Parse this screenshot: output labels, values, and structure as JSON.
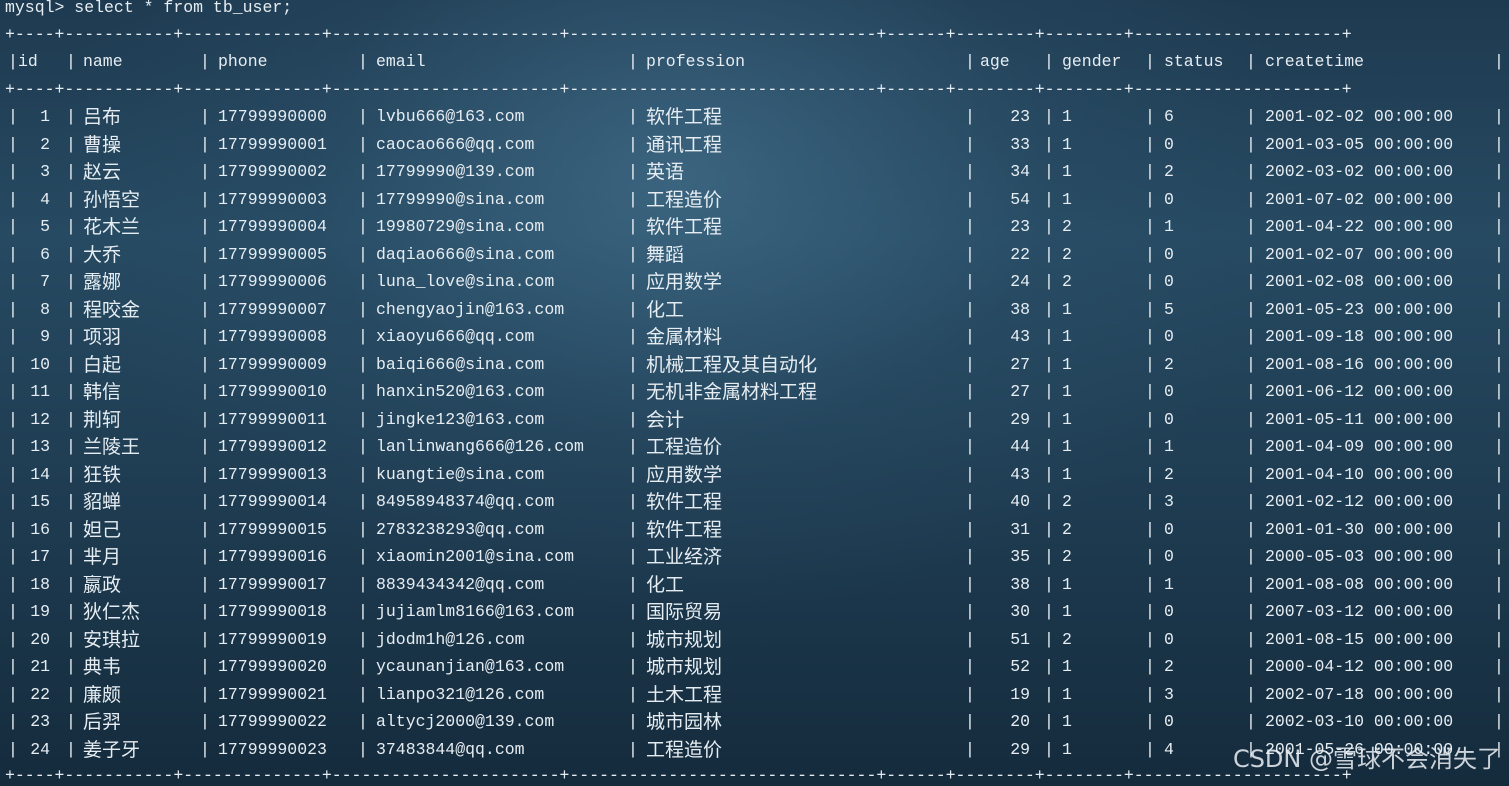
{
  "terminal": {
    "command": "mysql> select * from tb_user;",
    "border": "+----+-----------+--------------+-----------------------+-------------------------------+------+--------+--------+---------------------+",
    "columns": [
      "id",
      "name",
      "phone",
      "email",
      "profession",
      "age",
      "gender",
      "status",
      "createtime"
    ],
    "rows": [
      [
        "1",
        "吕布",
        "17799990000",
        "lvbu666@163.com",
        "软件工程",
        "23",
        "1",
        "6",
        "2001-02-02 00:00:00"
      ],
      [
        "2",
        "曹操",
        "17799990001",
        "caocao666@qq.com",
        "通讯工程",
        "33",
        "1",
        "0",
        "2001-03-05 00:00:00"
      ],
      [
        "3",
        "赵云",
        "17799990002",
        "17799990@139.com",
        "英语",
        "34",
        "1",
        "2",
        "2002-03-02 00:00:00"
      ],
      [
        "4",
        "孙悟空",
        "17799990003",
        "17799990@sina.com",
        "工程造价",
        "54",
        "1",
        "0",
        "2001-07-02 00:00:00"
      ],
      [
        "5",
        "花木兰",
        "17799990004",
        "19980729@sina.com",
        "软件工程",
        "23",
        "2",
        "1",
        "2001-04-22 00:00:00"
      ],
      [
        "6",
        "大乔",
        "17799990005",
        "daqiao666@sina.com",
        "舞蹈",
        "22",
        "2",
        "0",
        "2001-02-07 00:00:00"
      ],
      [
        "7",
        "露娜",
        "17799990006",
        "luna_love@sina.com",
        "应用数学",
        "24",
        "2",
        "0",
        "2001-02-08 00:00:00"
      ],
      [
        "8",
        "程咬金",
        "17799990007",
        "chengyaojin@163.com",
        "化工",
        "38",
        "1",
        "5",
        "2001-05-23 00:00:00"
      ],
      [
        "9",
        "项羽",
        "17799990008",
        "xiaoyu666@qq.com",
        "金属材料",
        "43",
        "1",
        "0",
        "2001-09-18 00:00:00"
      ],
      [
        "10",
        "白起",
        "17799990009",
        "baiqi666@sina.com",
        "机械工程及其自动化",
        "27",
        "1",
        "2",
        "2001-08-16 00:00:00"
      ],
      [
        "11",
        "韩信",
        "17799990010",
        "hanxin520@163.com",
        "无机非金属材料工程",
        "27",
        "1",
        "0",
        "2001-06-12 00:00:00"
      ],
      [
        "12",
        "荆轲",
        "17799990011",
        "jingke123@163.com",
        "会计",
        "29",
        "1",
        "0",
        "2001-05-11 00:00:00"
      ],
      [
        "13",
        "兰陵王",
        "17799990012",
        "lanlinwang666@126.com",
        "工程造价",
        "44",
        "1",
        "1",
        "2001-04-09 00:00:00"
      ],
      [
        "14",
        "狂铁",
        "17799990013",
        "kuangtie@sina.com",
        "应用数学",
        "43",
        "1",
        "2",
        "2001-04-10 00:00:00"
      ],
      [
        "15",
        "貂蝉",
        "17799990014",
        "84958948374@qq.com",
        "软件工程",
        "40",
        "2",
        "3",
        "2001-02-12 00:00:00"
      ],
      [
        "16",
        "妲己",
        "17799990015",
        "2783238293@qq.com",
        "软件工程",
        "31",
        "2",
        "0",
        "2001-01-30 00:00:00"
      ],
      [
        "17",
        "芈月",
        "17799990016",
        "xiaomin2001@sina.com",
        "工业经济",
        "35",
        "2",
        "0",
        "2000-05-03 00:00:00"
      ],
      [
        "18",
        "嬴政",
        "17799990017",
        "8839434342@qq.com",
        "化工",
        "38",
        "1",
        "1",
        "2001-08-08 00:00:00"
      ],
      [
        "19",
        "狄仁杰",
        "17799990018",
        "jujiamlm8166@163.com",
        "国际贸易",
        "30",
        "1",
        "0",
        "2007-03-12 00:00:00"
      ],
      [
        "20",
        "安琪拉",
        "17799990019",
        "jdodm1h@126.com",
        "城市规划",
        "51",
        "2",
        "0",
        "2001-08-15 00:00:00"
      ],
      [
        "21",
        "典韦",
        "17799990020",
        "ycaunanjian@163.com",
        "城市规划",
        "52",
        "1",
        "2",
        "2000-04-12 00:00:00"
      ],
      [
        "22",
        "廉颇",
        "17799990021",
        "lianpo321@126.com",
        "土木工程",
        "19",
        "1",
        "3",
        "2002-07-18 00:00:00"
      ],
      [
        "23",
        "后羿",
        "17799990022",
        "altycj2000@139.com",
        "城市园林",
        "20",
        "1",
        "0",
        "2002-03-10 00:00:00"
      ],
      [
        "24",
        "姜子牙",
        "17799990023",
        "37483844@qq.com",
        "工程造价",
        "29",
        "1",
        "4",
        "2001-05-26 00:00:00"
      ]
    ]
  },
  "watermark": "CSDN @雪球不会消失了",
  "colors": {
    "text": "#e6edf2",
    "background_dark": "#142b3c",
    "background_light": "#4a7896"
  }
}
